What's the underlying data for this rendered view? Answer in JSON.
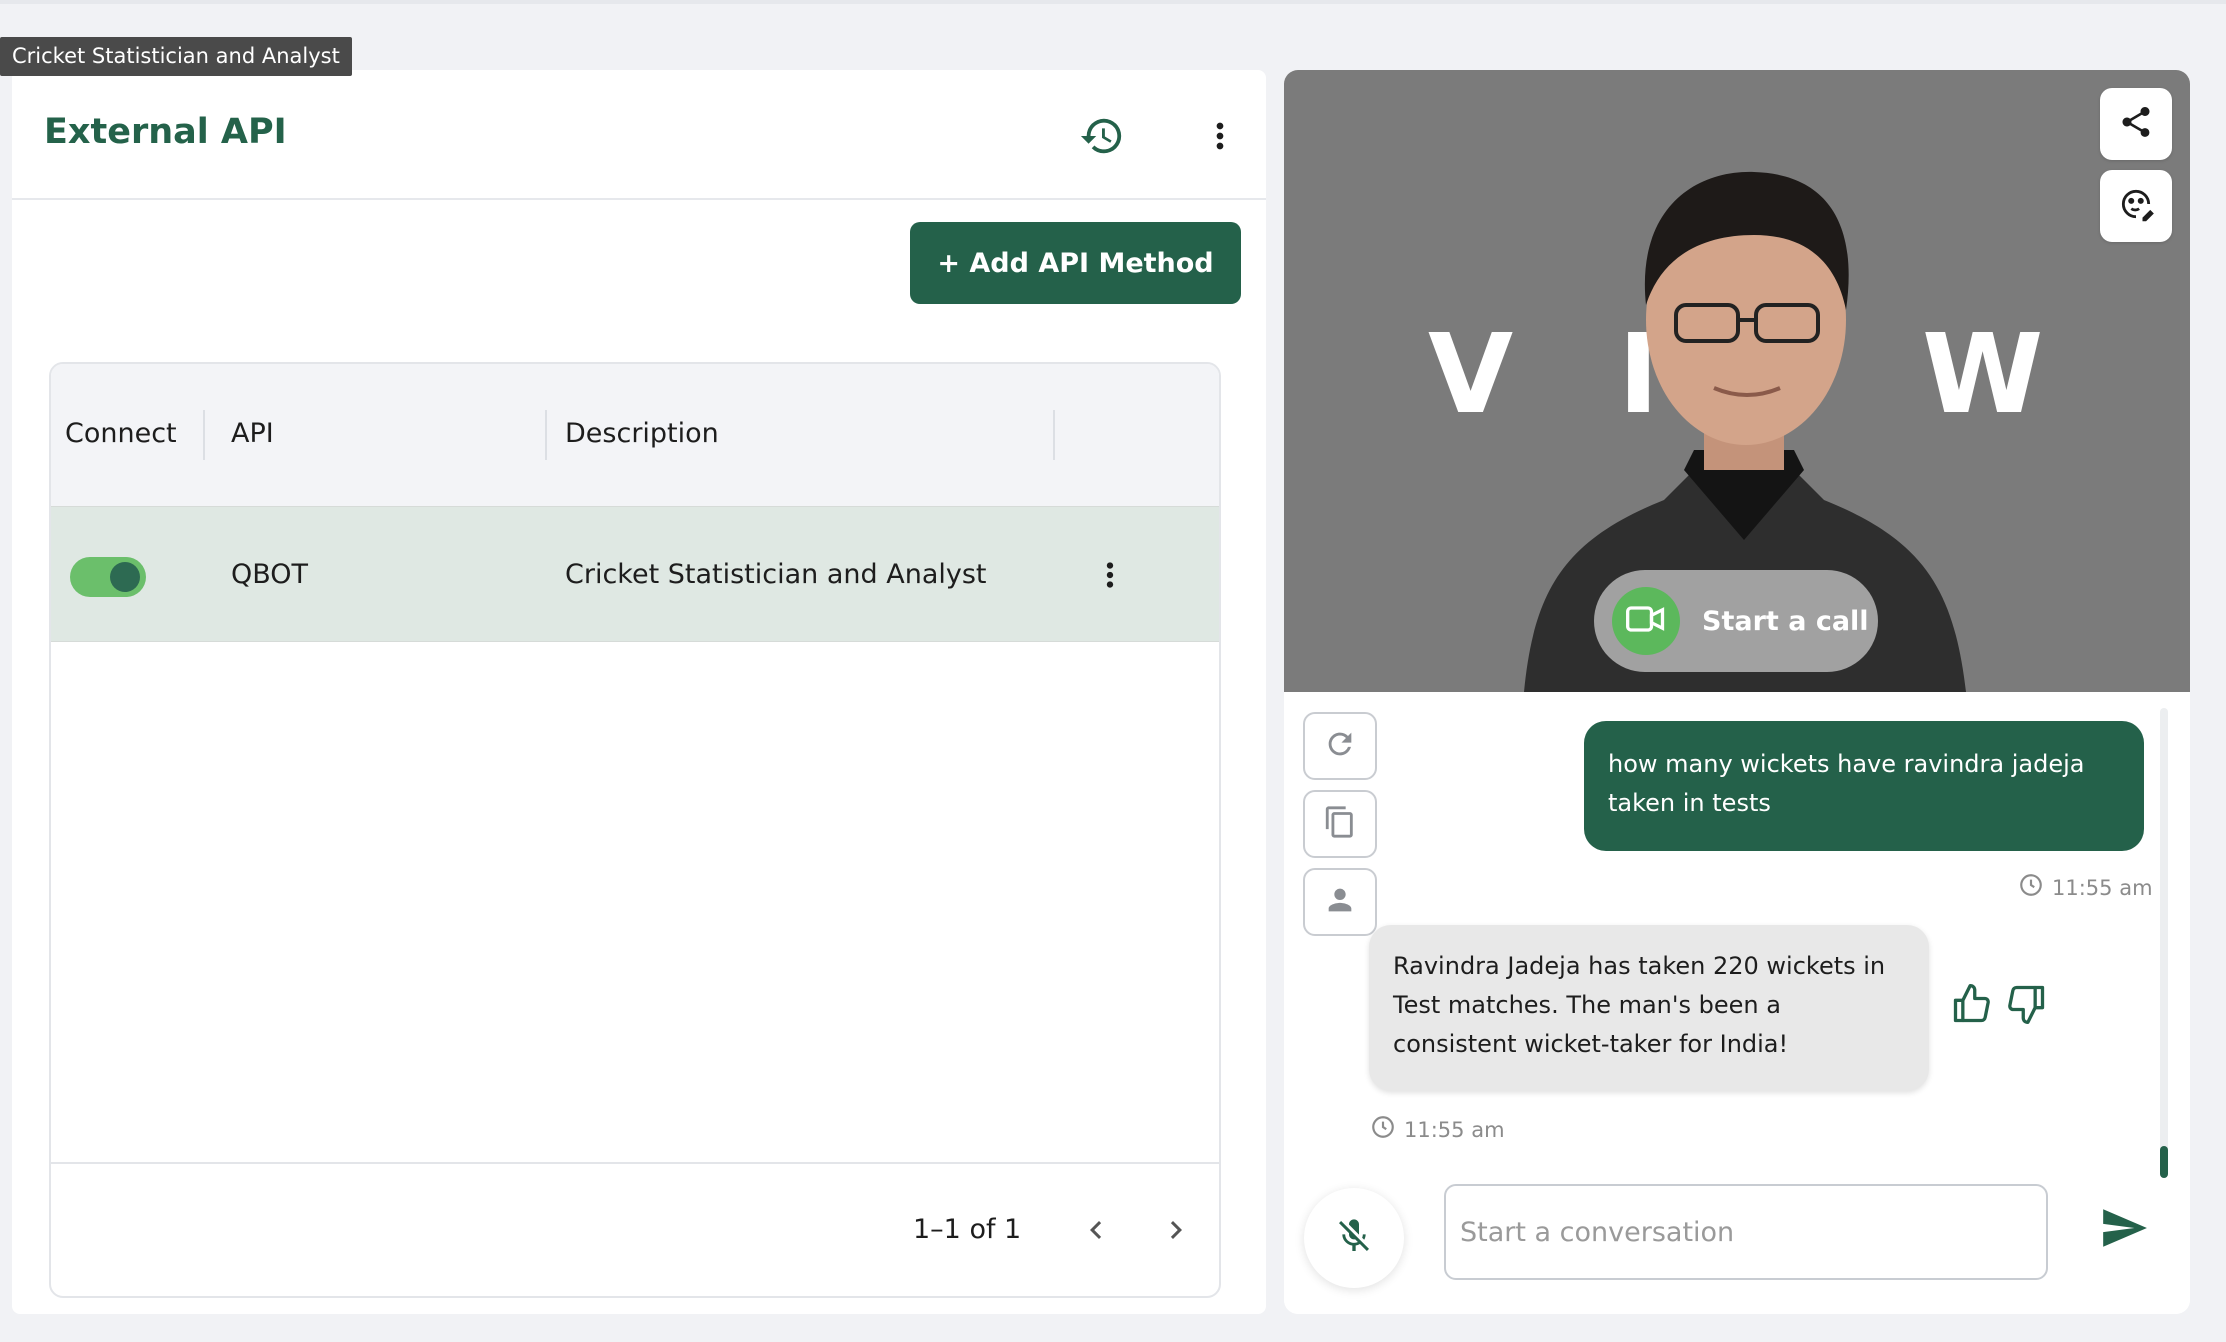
{
  "tooltip": "Cricket Statistician and Analyst",
  "panel": {
    "title": "External API",
    "add_button": "+ Add API Method"
  },
  "table": {
    "columns": [
      "Connect",
      "API",
      "Description"
    ],
    "rows": [
      {
        "connected": true,
        "api": "QBOT",
        "description": "Cricket Statistician and Analyst"
      }
    ],
    "pagination": "1–1 of 1"
  },
  "video": {
    "watermark_letters": [
      "V",
      "I",
      "W"
    ],
    "call_label": "Start a call"
  },
  "chat": {
    "messages": [
      {
        "role": "user",
        "text": "how many wickets have ravindra jadeja taken in tests",
        "time": "11:55 am"
      },
      {
        "role": "bot",
        "text": "Ravindra Jadeja has taken 220 wickets in Test matches. The man's been a consistent wicket-taker for India!",
        "time": "11:55 am"
      }
    ],
    "input_placeholder": "Start a conversation"
  },
  "icons": {
    "history": "history-icon",
    "more": "more-vert-icon",
    "share": "share-icon",
    "face": "face-edit-icon",
    "video": "video-camera-icon",
    "refresh": "refresh-icon",
    "copy": "copy-icon",
    "person": "person-icon",
    "thumb_up": "thumb-up-icon",
    "thumb_down": "thumb-down-icon",
    "mic_off": "mic-off-icon",
    "send": "send-icon",
    "clock": "clock-icon"
  },
  "colors": {
    "brand": "#24614a",
    "toggle_on": "#6bbf6b",
    "row_highlight": "#dfe8e3",
    "call_icon": "#5cb85c"
  }
}
